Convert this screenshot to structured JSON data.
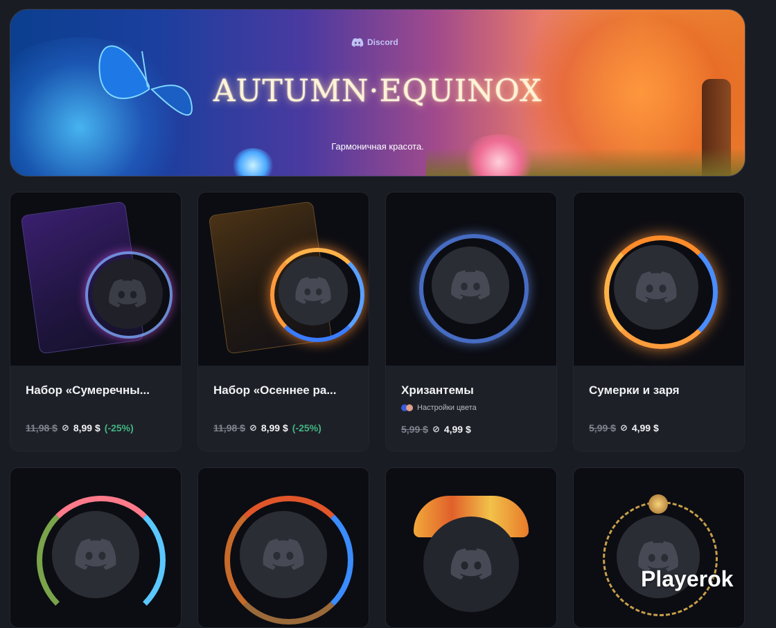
{
  "banner": {
    "brand": "Discord",
    "title": "AUTUMN·EQUINOX",
    "subtitle": "Гармоничная красота."
  },
  "products": [
    {
      "title": "Набор «Сумеречны...",
      "old_price": "11,98 $",
      "new_price": "8,99 $",
      "discount": "(-25%)"
    },
    {
      "title": "Набор «Осеннее ра...",
      "old_price": "11,98 $",
      "new_price": "8,99 $",
      "discount": "(-25%)"
    },
    {
      "title": "Хризантемы",
      "subline": "Настройки цвета",
      "old_price": "5,99 $",
      "new_price": "4,99 $"
    },
    {
      "title": "Сумерки и заря",
      "old_price": "5,99 $",
      "new_price": "4,99 $"
    }
  ],
  "watermark": "Playerok",
  "colors": {
    "background": "#1a1c23",
    "card": "#1e2028",
    "discount": "#43b581",
    "old_price": "#80848e"
  }
}
